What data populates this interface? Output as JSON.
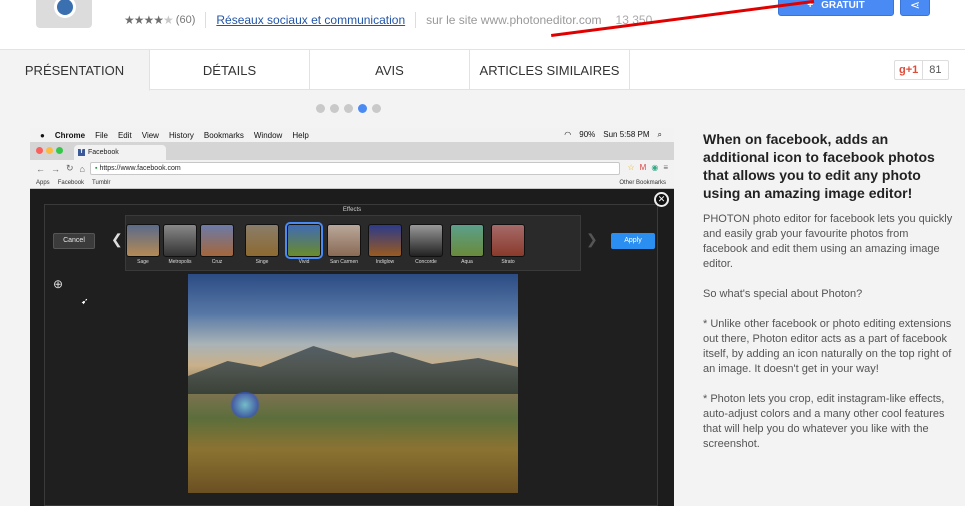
{
  "header": {
    "rating_count": "(60)",
    "category_link": "Réseaux sociaux et communication",
    "site_text": "sur le site www.photoneditor.com",
    "users_text": "13 350",
    "free_button": "GRATUIT",
    "stars": 4
  },
  "tabs": [
    {
      "label": "PRÉSENTATION"
    },
    {
      "label": "DÉTAILS"
    },
    {
      "label": "AVIS"
    },
    {
      "label": "ARTICLES SIMILAIRES"
    }
  ],
  "gplus": {
    "label": "g+1",
    "count": "81"
  },
  "carousel": {
    "dots": 5,
    "active_index": 3
  },
  "screenshot": {
    "menubar": {
      "app": "Chrome",
      "items": [
        "File",
        "Edit",
        "View",
        "History",
        "Bookmarks",
        "Window",
        "Help"
      ],
      "battery": "90%",
      "clock": "Sun 5:58 PM"
    },
    "browser_tab": "Facebook",
    "address": "https://www.facebook.com",
    "bookmarks": [
      "Apps",
      "Facebook",
      "Tumblr"
    ],
    "other_bookmarks": "Other Bookmarks",
    "editor": {
      "title": "Effects",
      "cancel": "Cancel",
      "apply": "Apply",
      "filters": [
        "Sage",
        "Metropolis",
        "Cruz",
        "Singe",
        "Vivid",
        "San Carmen",
        "Indiglow",
        "Concorde",
        "Aqua",
        "Strato"
      ]
    }
  },
  "description": {
    "title": "When on facebook, adds an additional icon to facebook photos that allows you to edit any photo using an amazing image editor!",
    "paragraphs": [
      "PHOTON photo editor for facebook lets you quickly and easily grab your favourite photos from facebook and edit them using an amazing image editor.",
      "So what's special about Photon?",
      "* Unlike other facebook or photo editing extensions out there, Photon editor acts as a part of facebook itself, by adding an icon naturally on the top right of an image. It doesn't get in your way!",
      "* Photon lets you crop, edit instagram-like effects, auto-adjust colors and a many other cool features that will help you do whatever you like with the screenshot."
    ]
  },
  "colors": {
    "accent": "#4a8af4",
    "annotation_arrow": "#e00000",
    "facebook": "#3b5998"
  }
}
